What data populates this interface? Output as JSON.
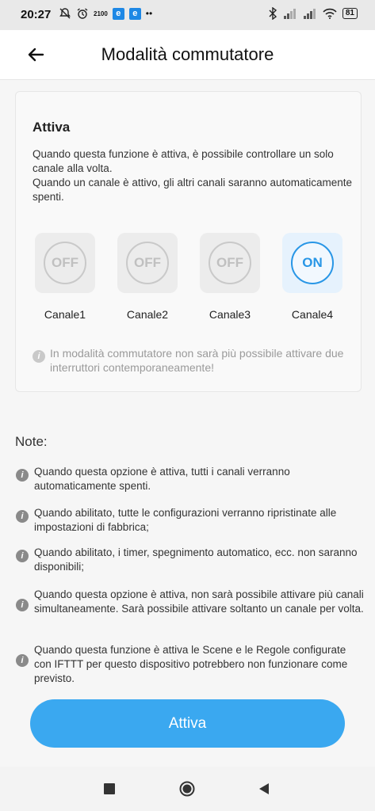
{
  "status_bar": {
    "time": "20:27",
    "net_speed": "2100",
    "badge1": "e",
    "badge2": "e",
    "more": "••",
    "battery": "81"
  },
  "header": {
    "back_icon": "arrow-left-icon",
    "title": "Modalità commutatore"
  },
  "card": {
    "title": "Attiva",
    "description_line1": "Quando questa funzione è attiva, è possibile controllare un solo canale alla volta.",
    "description_line2": "Quando un canale è attivo, gli altri canali saranno automaticamente spenti.",
    "channels": [
      {
        "label": "Canale1",
        "state": "OFF"
      },
      {
        "label": "Canale2",
        "state": "OFF"
      },
      {
        "label": "Canale3",
        "state": "OFF"
      },
      {
        "label": "Canale4",
        "state": "ON"
      }
    ],
    "hint": "In modalità commutatore non sarà più possibile attivare due interruttori contemporaneamente!"
  },
  "notes": {
    "title": "Note:",
    "items": [
      "Quando questa opzione è attiva, tutti i canali verranno automaticamente spenti.",
      "Quando abilitato, tutte le configurazioni verranno ripristinate alle impostazioni di fabbrica;",
      "Quando abilitato, i timer, spegnimento automatico, ecc. non saranno disponibili;",
      "Quando questa opzione è attiva, non sarà possibile attivare più canali simultaneamente. Sarà possibile attivare soltanto un canale per volta.",
      "Quando questa funzione è attiva le Scene e le Regole configurate con IFTTT per questo dispositivo potrebbero non funzionare come previsto."
    ]
  },
  "action": {
    "label": "Attiva"
  },
  "colors": {
    "accent": "#3aa8f0",
    "channel_on": "#2896e6"
  }
}
